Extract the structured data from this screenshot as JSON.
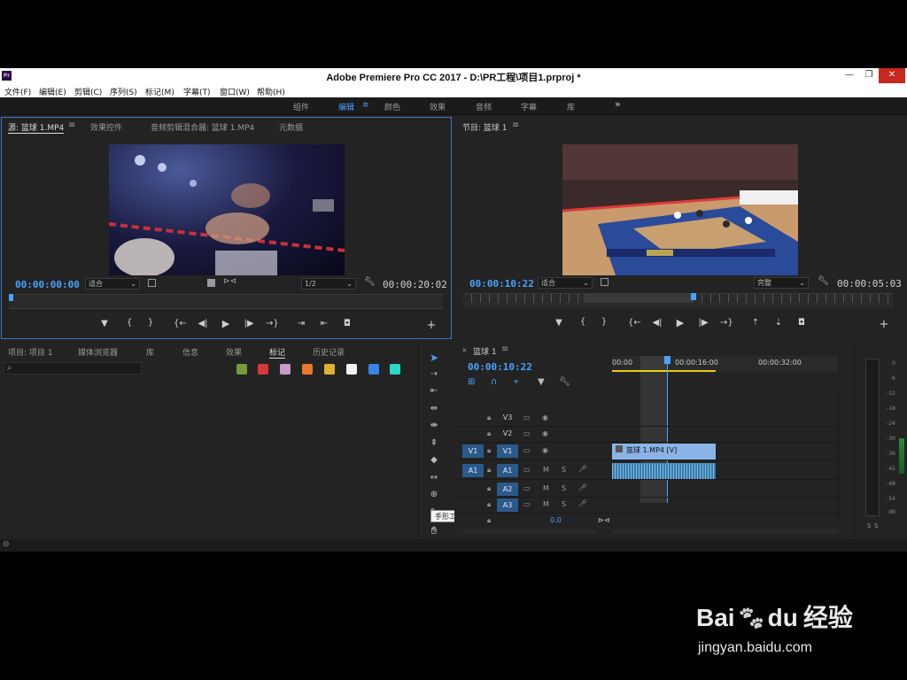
{
  "window": {
    "title": "Adobe Premiere Pro CC 2017 - D:\\PR工程\\项目1.prproj *",
    "logo": "Pr",
    "minimize": "—",
    "restore": "❐",
    "close": "✕"
  },
  "menu": [
    "文件(F)",
    "编辑(E)",
    "剪辑(C)",
    "序列(S)",
    "标记(M)",
    "字幕(T)",
    "窗口(W)",
    "帮助(H)"
  ],
  "workspaces": {
    "items": [
      "组件",
      "编辑",
      "颜色",
      "效果",
      "音频",
      "字幕",
      "库"
    ],
    "active": "编辑",
    "more": "»",
    "menu": "≡"
  },
  "source": {
    "tabs": [
      "源: 篮球 1.MP4",
      "效果控件",
      "音频剪辑混合器: 篮球 1.MP4",
      "元数据"
    ],
    "tab_menu": "≡",
    "timecode_in": "00:00:00:00",
    "fit": "适合",
    "resolution": "1/2",
    "timecode_dur": "00:00:20:02"
  },
  "program": {
    "title": "节目: 篮球 1",
    "menu": "≡",
    "timecode": "00:00:10:22",
    "fit": "适合",
    "quality": "完整",
    "duration": "00:00:05:03"
  },
  "controls": {
    "marker": "▼",
    "in": "{",
    "out": "}",
    "goto_in": "{←",
    "step_back": "◀|",
    "play": "▶",
    "step_fwd": "|▶",
    "goto_out": "→}",
    "insert": "⇥",
    "overwrite": "⇤",
    "lift": "⇡",
    "extract": "⇣",
    "export": "◘",
    "add": "+"
  },
  "project": {
    "tabs": [
      "项目: 项目 1",
      "媒体浏览器",
      "库",
      "信息",
      "效果",
      "标记",
      "历史记录"
    ],
    "active": "标记",
    "search_icon": "⌕",
    "colors": [
      "#7a9a3a",
      "#d8383c",
      "#c89ac8",
      "#e8782a",
      "#e0b030",
      "#f2f2f2",
      "#3a84e8",
      "#2ad8c8"
    ]
  },
  "tools": {
    "tooltip": "手形工具 (H)"
  },
  "timeline": {
    "tab": "篮球 1",
    "close": "×",
    "menu": "≡",
    "timecode": "00:00:10:22",
    "ruler": [
      "00:00",
      "00:00:16:00",
      "00:00:32:00"
    ],
    "tracks_video": [
      "V3",
      "V2",
      "V1"
    ],
    "tracks_audio": [
      "A1",
      "A2",
      "A3"
    ],
    "src_v": "V1",
    "src_a": "A1",
    "mute": "M",
    "solo": "S",
    "master": "0.0",
    "clip_label": "篮球 1.MP4 [V]"
  },
  "meter": {
    "labels": [
      "0",
      "-6",
      "-12",
      "-18",
      "-24",
      "-30",
      "-36",
      "-42",
      "-48",
      "-54",
      "dB"
    ],
    "solo_l": "S",
    "solo_r": "S"
  },
  "watermark": {
    "brand_a": "Bai",
    "brand_b": "du",
    "brand_c": "经验",
    "url": "jingyan.baidu.com"
  }
}
